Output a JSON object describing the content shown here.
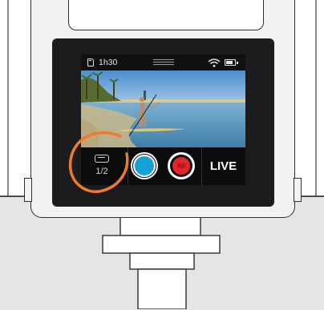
{
  "status_bar": {
    "sd_icon": "sd-card-icon",
    "recording_time_left": "1h30",
    "menu_icon": "menu-lines-icon",
    "wifi_icon": "wifi-icon",
    "battery_icon": "battery-icon"
  },
  "controls": {
    "resolution_icon": "resolution-icon",
    "resolution_label": "1/2",
    "photo_icon": "photo-shutter-icon",
    "record_icon": "record-icon",
    "live_label": "LIVE"
  },
  "colors": {
    "photo_button": "#16a0d8",
    "record_button": "#e2262b",
    "callout_circle": "#f07a2a"
  }
}
